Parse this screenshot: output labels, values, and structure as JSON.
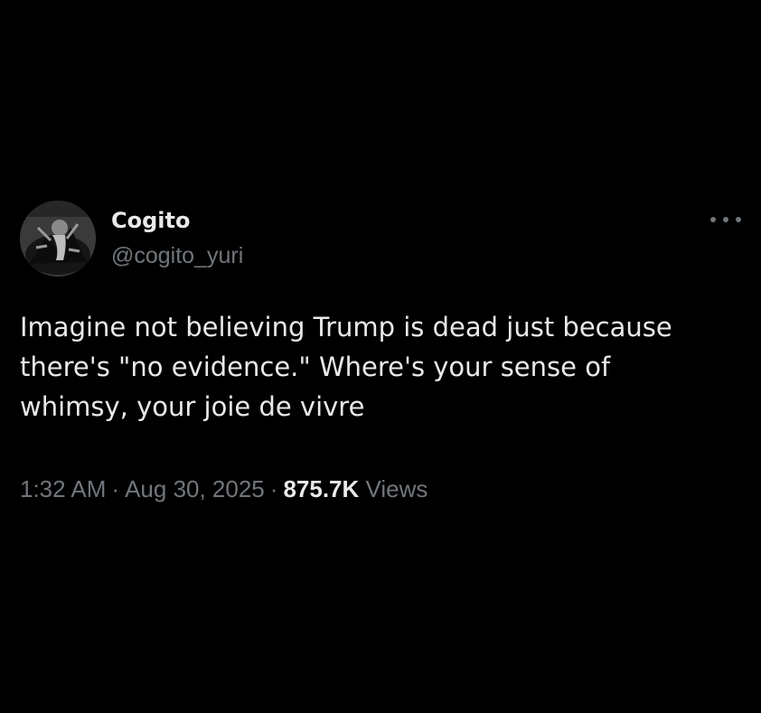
{
  "tweet": {
    "display_name": "Cogito",
    "handle": "@cogito_yuri",
    "text": "Imagine not believing Trump is dead just because\nthere's \"no evidence.\" Where's your sense of\nwhimsy, your joie de vivre",
    "time": "1:32 AM",
    "separator": "·",
    "date": "Aug 30, 2025",
    "views_count": "875.7K",
    "views_label": "Views",
    "more_icon": "more-horizontal-icon"
  },
  "colors": {
    "background": "#000000",
    "primary_text": "#e7e9ea",
    "secondary_text": "#71767b"
  }
}
